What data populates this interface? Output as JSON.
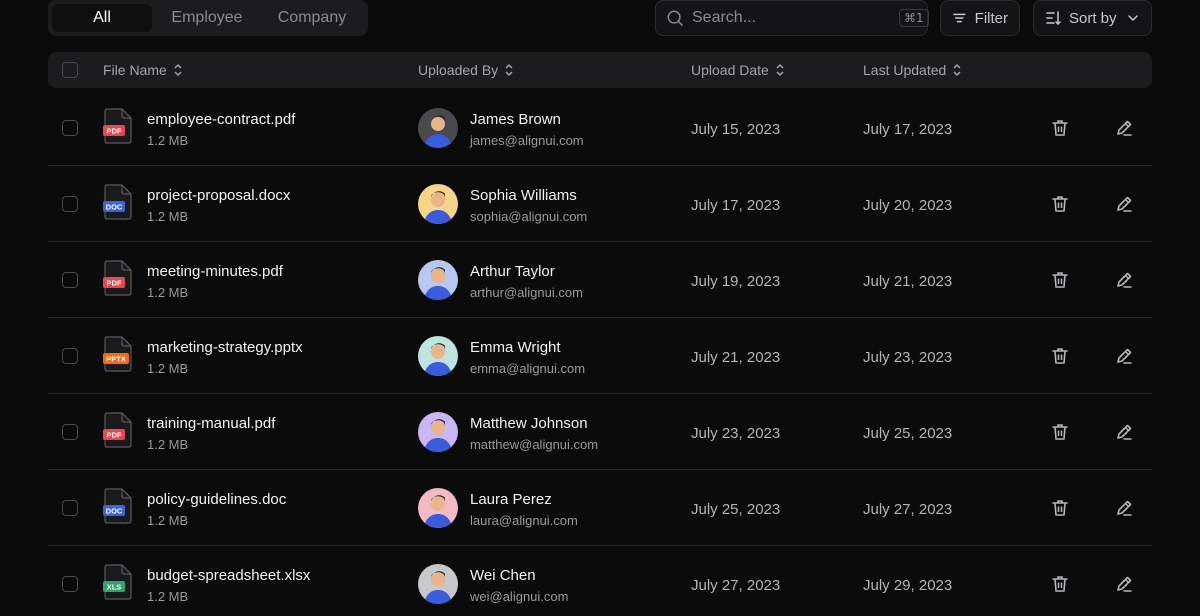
{
  "tabs": [
    {
      "label": "All",
      "active": true
    },
    {
      "label": "Employee",
      "active": false
    },
    {
      "label": "Company",
      "active": false
    }
  ],
  "search": {
    "placeholder": "Search...",
    "shortcut": "⌘1"
  },
  "toolbar": {
    "filter_label": "Filter",
    "sort_label": "Sort by"
  },
  "table": {
    "headers": {
      "file_name": "File Name",
      "uploaded_by": "Uploaded By",
      "upload_date": "Upload Date",
      "last_updated": "Last Updated"
    },
    "rows": [
      {
        "file": "employee-contract.pdf",
        "size": "1.2 MB",
        "type": "PDF",
        "type_color": "#e5484d",
        "user": "James Brown",
        "email": "james@alignui.com",
        "avatar_bg": "#4a4a4e",
        "uploaded": "July 15, 2023",
        "updated": "July 17, 2023"
      },
      {
        "file": "project-proposal.docx",
        "size": "1.2 MB",
        "type": "DOC",
        "type_color": "#3e63dd",
        "user": "Sophia Williams",
        "email": "sophia@alignui.com",
        "avatar_bg": "#f5d58a",
        "uploaded": "July 17, 2023",
        "updated": "July 20, 2023"
      },
      {
        "file": "meeting-minutes.pdf",
        "size": "1.2 MB",
        "type": "PDF",
        "type_color": "#e5484d",
        "user": "Arthur Taylor",
        "email": "arthur@alignui.com",
        "avatar_bg": "#b8c7f0",
        "uploaded": "July 19, 2023",
        "updated": "July 21, 2023"
      },
      {
        "file": "marketing-strategy.pptx",
        "size": "1.2 MB",
        "type": "PPTX",
        "type_color": "#f76b15",
        "user": "Emma Wright",
        "email": "emma@alignui.com",
        "avatar_bg": "#bfe3df",
        "uploaded": "July 21, 2023",
        "updated": "July 23, 2023"
      },
      {
        "file": "training-manual.pdf",
        "size": "1.2 MB",
        "type": "PDF",
        "type_color": "#e5484d",
        "user": "Matthew Johnson",
        "email": "matthew@alignui.com",
        "avatar_bg": "#c9b6f2",
        "uploaded": "July 23, 2023",
        "updated": "July 25, 2023"
      },
      {
        "file": "policy-guidelines.doc",
        "size": "1.2 MB",
        "type": "DOC",
        "type_color": "#3e63dd",
        "user": "Laura Perez",
        "email": "laura@alignui.com",
        "avatar_bg": "#f3b9c4",
        "uploaded": "July 25, 2023",
        "updated": "July 27, 2023"
      },
      {
        "file": "budget-spreadsheet.xlsx",
        "size": "1.2 MB",
        "type": "XLS",
        "type_color": "#30a46c",
        "user": "Wei Chen",
        "email": "wei@alignui.com",
        "avatar_bg": "#c8c8cc",
        "uploaded": "July 27, 2023",
        "updated": "July 29, 2023"
      }
    ]
  }
}
